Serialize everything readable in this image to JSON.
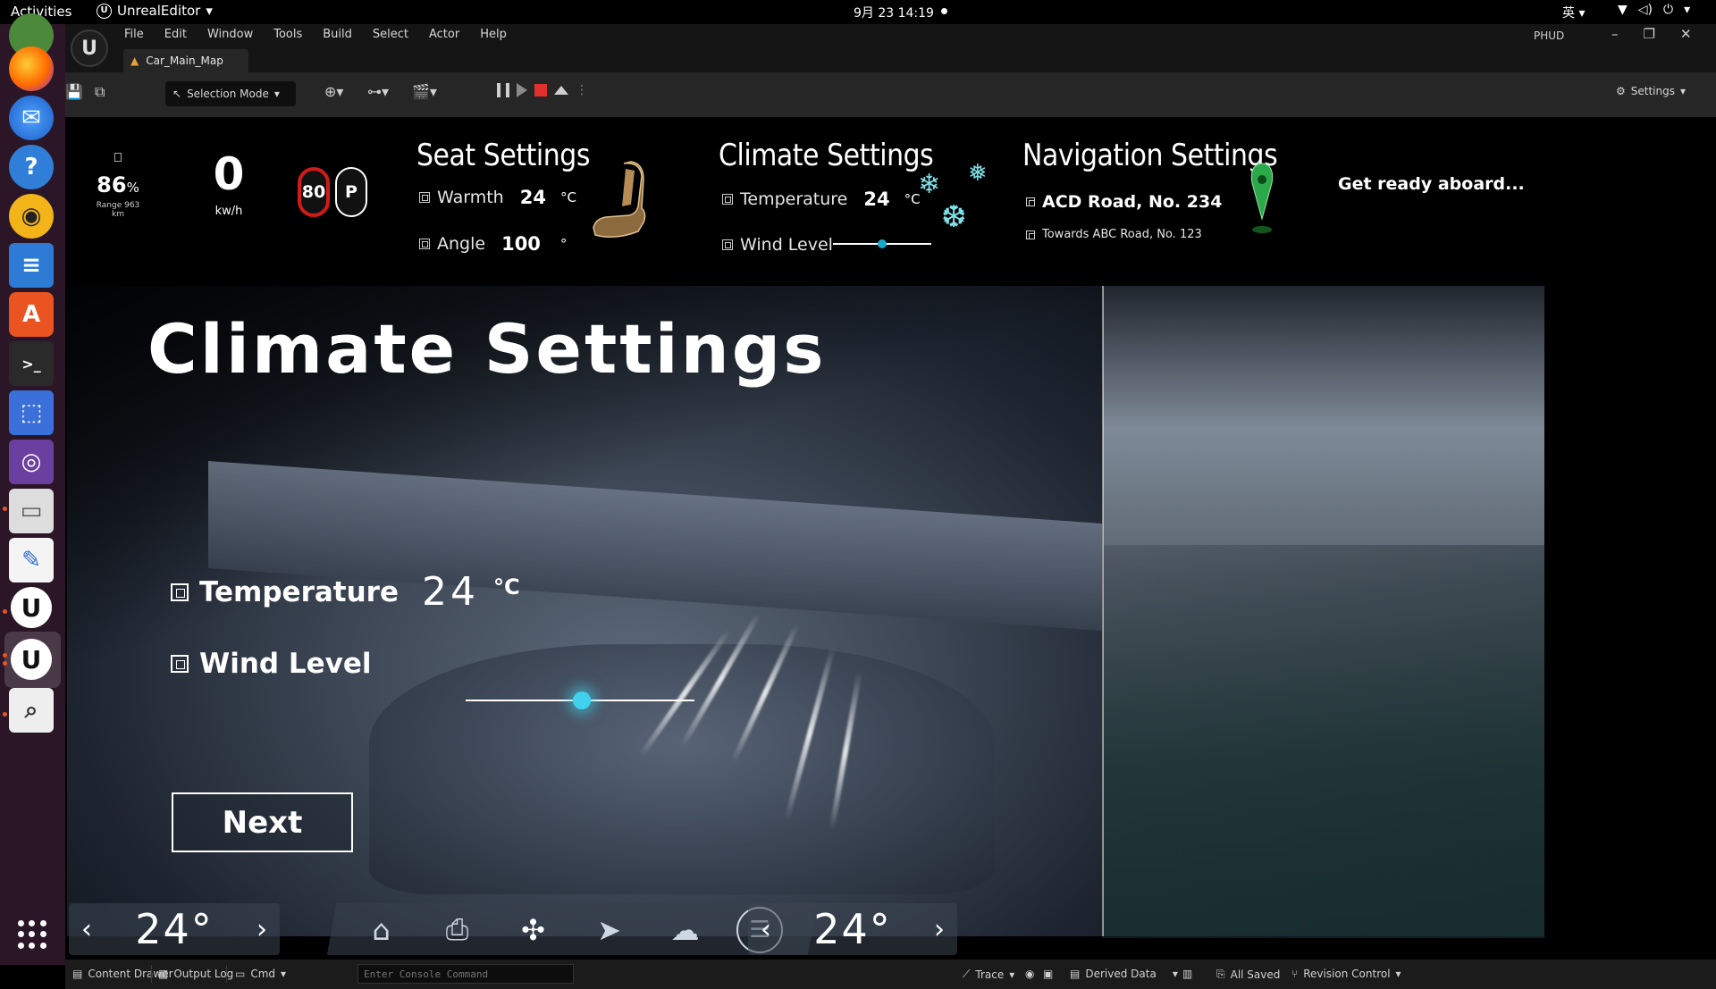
{
  "topbar": {
    "activities": "Activities",
    "app_name": "UnrealEditor",
    "clock": "9月 23  14:19",
    "ime": "英"
  },
  "menubar": {
    "items": [
      "File",
      "Edit",
      "Window",
      "Tools",
      "Build",
      "Select",
      "Actor",
      "Help"
    ],
    "map_tab": "Car_Main_Map",
    "project": "PHUD"
  },
  "toolbar": {
    "selection_mode": "Selection Mode",
    "settings": "Settings"
  },
  "hud": {
    "battery_pct": "86",
    "battery_unit": "%",
    "range": "Range 963 km",
    "speed": "0",
    "speed_unit": "kw/h",
    "speed_limit": "80",
    "gear": "P",
    "seat": {
      "title": "Seat Settings",
      "warmth_label": "Warmth",
      "warmth_value": "24",
      "warmth_unit": "°C",
      "angle_label": "Angle",
      "angle_value": "100",
      "angle_unit": "°"
    },
    "climate": {
      "title": "Climate Settings",
      "temperature_label": "Temperature",
      "temperature_value": "24",
      "temperature_unit": "°C",
      "wind_label": "Wind Level"
    },
    "navigation": {
      "title": "Navigation Settings",
      "destination": "ACD Road, No. 234",
      "via": "Towards ABC Road, No. 123"
    },
    "ready_text": "Get ready aboard..."
  },
  "panel": {
    "title": "Climate Settings",
    "temperature_label": "Temperature",
    "temperature_value": "24",
    "temperature_unit": "°C",
    "wind_label": "Wind Level",
    "next_label": "Next"
  },
  "bottomnav": {
    "left_temp": "24°",
    "right_temp": "24°",
    "prev_glyph": "‹",
    "next_glyph": "›"
  },
  "statusbar": {
    "content_drawer": "Content Drawer",
    "output_log": "Output Log",
    "cmd": "Cmd",
    "console_placeholder": "Enter Console Command",
    "trace": "Trace",
    "derived_data": "Derived Data",
    "all_saved": "All Saved",
    "revision_control": "Revision Control"
  },
  "colors": {
    "accent_cyan": "#3fd1ee",
    "limit_red": "#d11a1a",
    "stop_red": "#e0312c",
    "dock_bg": "#2b1627"
  }
}
